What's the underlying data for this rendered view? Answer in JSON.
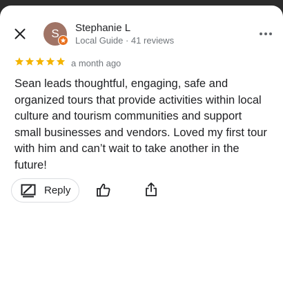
{
  "reviewer": {
    "initial": "S",
    "name": "Stephanie L",
    "meta": "Local Guide · 41 reviews"
  },
  "rating": {
    "stars": 5,
    "max": 5,
    "color": "#f4b400"
  },
  "date": "a month ago",
  "review_text": "Sean leads thoughtful, engaging, safe and organized tours that provide activities within local culture and tourism communities and support small businesses and vendors. Loved my first tour with him and can’t wait to take another in the future!",
  "actions": {
    "reply_label": "Reply"
  },
  "icons": {
    "close": "close-icon",
    "more": "more-vertical-icon",
    "reply": "reply-icon",
    "like": "thumbs-up-icon",
    "share": "share-icon",
    "badge": "local-guide-badge-icon"
  },
  "colors": {
    "avatar": "#a07466",
    "badge": "#e8711f",
    "text": "#202124",
    "secondary_text": "#70757a"
  }
}
